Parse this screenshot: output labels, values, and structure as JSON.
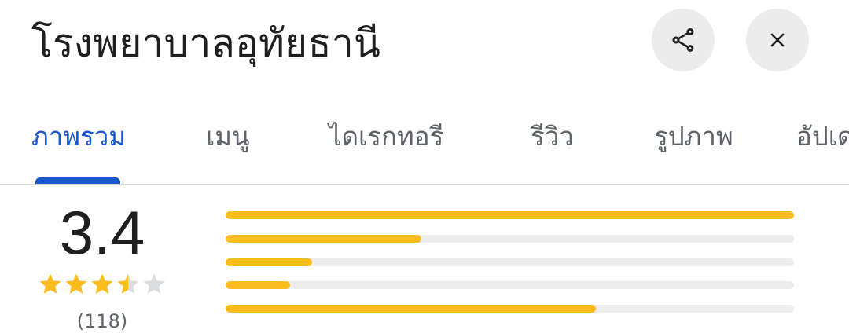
{
  "place": {
    "title": "โรงพยาบาลอุทัยธานี"
  },
  "header_actions": {
    "share_icon": "share-icon",
    "close_icon": "close-icon"
  },
  "tabs": [
    {
      "label": "ภาพรวม",
      "active": true
    },
    {
      "label": "เมนู",
      "active": false
    },
    {
      "label": "ไดเรกทอรี",
      "active": false
    },
    {
      "label": "รีวิว",
      "active": false
    },
    {
      "label": "รูปภาพ",
      "active": false
    },
    {
      "label": "อัปเดต",
      "active": false
    }
  ],
  "rating": {
    "score": "3.4",
    "stars_value": 3.4,
    "count": "(118)",
    "distribution": [
      {
        "stars": 5,
        "fraction": 1.0
      },
      {
        "stars": 4,
        "fraction": 0.345
      },
      {
        "stars": 3,
        "fraction": 0.152
      },
      {
        "stars": 2,
        "fraction": 0.114
      },
      {
        "stars": 1,
        "fraction": 0.652
      }
    ]
  },
  "colors": {
    "accent": "#1a57c9",
    "star": "#fbbc1f",
    "star_empty": "#dadce0",
    "bar_track": "#ededed"
  }
}
